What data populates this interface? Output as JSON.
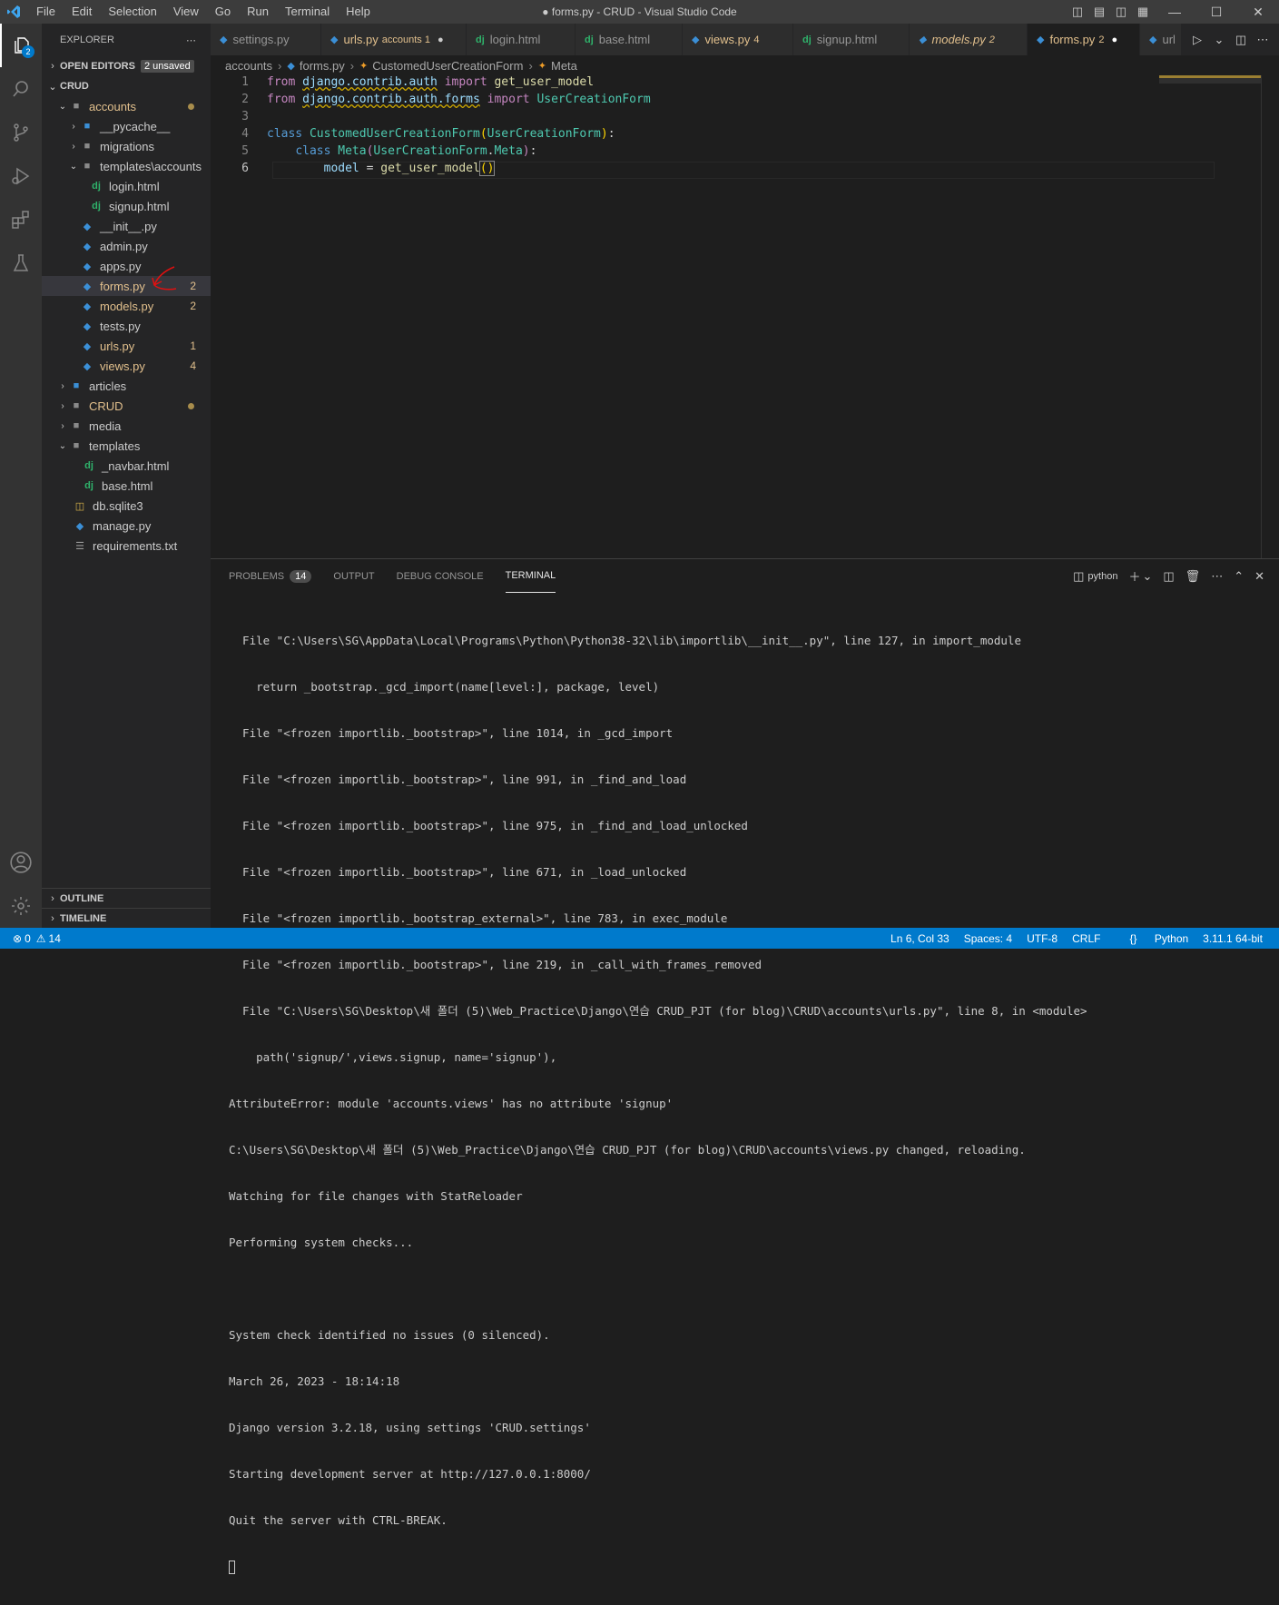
{
  "titlebar": {
    "menu": [
      "File",
      "Edit",
      "Selection",
      "View",
      "Go",
      "Run",
      "Terminal",
      "Help"
    ],
    "title": "● forms.py - CRUD - Visual Studio Code"
  },
  "activity": {
    "explorer_badge": "2"
  },
  "explorer": {
    "header": "EXPLORER",
    "open_editors": "OPEN EDITORS",
    "unsaved": "2 unsaved",
    "root": "CRUD",
    "items": [
      {
        "label": "accounts",
        "count": ""
      },
      {
        "label": "__pycache__",
        "count": ""
      },
      {
        "label": "migrations",
        "count": ""
      },
      {
        "label": "templates\\accounts",
        "count": ""
      },
      {
        "label": "login.html",
        "count": ""
      },
      {
        "label": "signup.html",
        "count": ""
      },
      {
        "label": "__init__.py",
        "count": ""
      },
      {
        "label": "admin.py",
        "count": ""
      },
      {
        "label": "apps.py",
        "count": ""
      },
      {
        "label": "forms.py",
        "count": "2"
      },
      {
        "label": "models.py",
        "count": "2"
      },
      {
        "label": "tests.py",
        "count": ""
      },
      {
        "label": "urls.py",
        "count": "1"
      },
      {
        "label": "views.py",
        "count": "4"
      },
      {
        "label": "articles",
        "count": ""
      },
      {
        "label": "CRUD",
        "count": ""
      },
      {
        "label": "media",
        "count": ""
      },
      {
        "label": "templates",
        "count": ""
      },
      {
        "label": "_navbar.html",
        "count": ""
      },
      {
        "label": "base.html",
        "count": ""
      },
      {
        "label": "db.sqlite3",
        "count": ""
      },
      {
        "label": "manage.py",
        "count": ""
      },
      {
        "label": "requirements.txt",
        "count": ""
      }
    ],
    "outline": "OUTLINE",
    "timeline": "TIMELINE"
  },
  "tabs": [
    {
      "label": "settings.py",
      "sub": ""
    },
    {
      "label": "urls.py",
      "sub": "accounts 1"
    },
    {
      "label": "login.html",
      "sub": ""
    },
    {
      "label": "base.html",
      "sub": ""
    },
    {
      "label": "views.py",
      "sub": "4"
    },
    {
      "label": "signup.html",
      "sub": ""
    },
    {
      "label": "models.py",
      "sub": "2"
    },
    {
      "label": "forms.py",
      "sub": "2"
    },
    {
      "label": "url",
      "sub": ""
    }
  ],
  "breadcrumb": [
    "accounts",
    "forms.py",
    "CustomedUserCreationForm",
    "Meta"
  ],
  "code": {
    "line_numbers": [
      "1",
      "2",
      "3",
      "4",
      "5",
      "6"
    ],
    "l1": {
      "from": "from",
      "mod": "django.contrib.auth",
      "import": "import",
      "name": "get_user_model"
    },
    "l2": {
      "from": "from",
      "mod": "django.contrib.auth.forms",
      "import": "import",
      "name": "UserCreationForm"
    },
    "l4": {
      "class": "class",
      "name": "CustomedUserCreationForm",
      "base": "UserCreationForm"
    },
    "l5": {
      "class": "class",
      "name": "Meta",
      "base1": "UserCreationForm",
      "base2": "Meta"
    },
    "l6": {
      "var": "model",
      "op": " = ",
      "fn": "get_user_model",
      "paren": "()"
    }
  },
  "panel": {
    "tabs": [
      "PROBLEMS",
      "OUTPUT",
      "DEBUG CONSOLE",
      "TERMINAL"
    ],
    "problems_count": "14",
    "shell": "python",
    "terminal_lines": [
      "  File \"C:\\Users\\SG\\AppData\\Local\\Programs\\Python\\Python38-32\\lib\\importlib\\__init__.py\", line 127, in import_module",
      "    return _bootstrap._gcd_import(name[level:], package, level)",
      "  File \"<frozen importlib._bootstrap>\", line 1014, in _gcd_import",
      "  File \"<frozen importlib._bootstrap>\", line 991, in _find_and_load",
      "  File \"<frozen importlib._bootstrap>\", line 975, in _find_and_load_unlocked",
      "  File \"<frozen importlib._bootstrap>\", line 671, in _load_unlocked",
      "  File \"<frozen importlib._bootstrap_external>\", line 783, in exec_module",
      "  File \"<frozen importlib._bootstrap>\", line 219, in _call_with_frames_removed",
      "  File \"C:\\Users\\SG\\Desktop\\새 폴더 (5)\\Web_Practice\\Django\\연습 CRUD_PJT (for blog)\\CRUD\\accounts\\urls.py\", line 8, in <module>",
      "    path('signup/',views.signup, name='signup'),",
      "AttributeError: module 'accounts.views' has no attribute 'signup'",
      "C:\\Users\\SG\\Desktop\\새 폴더 (5)\\Web_Practice\\Django\\연습 CRUD_PJT (for blog)\\CRUD\\accounts\\views.py changed, reloading.",
      "Watching for file changes with StatReloader",
      "Performing system checks...",
      "",
      "System check identified no issues (0 silenced).",
      "March 26, 2023 - 18:14:18",
      "Django version 3.2.18, using settings 'CRUD.settings'",
      "Starting development server at http://127.0.0.1:8000/",
      "Quit the server with CTRL-BREAK."
    ]
  },
  "status": {
    "errors": "0",
    "warnings": "14",
    "position": "Ln 6, Col 33",
    "spaces": "Spaces: 4",
    "encoding": "UTF-8",
    "eol": "CRLF",
    "language": "Python",
    "interpreter": "3.11.1 64-bit"
  },
  "colors": {
    "accent": "#007acc",
    "modified": "#e2c08d",
    "annotation": "#e01010"
  }
}
